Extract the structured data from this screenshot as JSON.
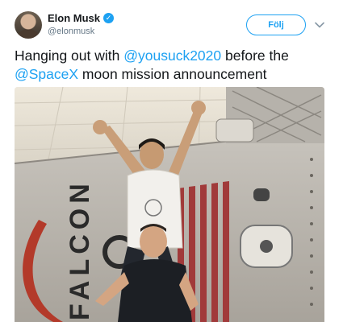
{
  "tweet": {
    "author_name": "Elon Musk",
    "author_handle": "@elonmusk",
    "verified_icon": "verified-badge-icon",
    "follow_label": "Följ",
    "menu_icon": "chevron-down-icon",
    "text_before": "Hanging out with ",
    "mention_1": "@yousuck2020",
    "text_middle": " before the ",
    "mention_2": "@SpaceX",
    "text_after": " moon mission announcement",
    "photo_wall_lettering": "FALCON 9",
    "colors": {
      "accent": "#1da1f2",
      "text": "#14171a",
      "secondary_text": "#657786"
    }
  }
}
